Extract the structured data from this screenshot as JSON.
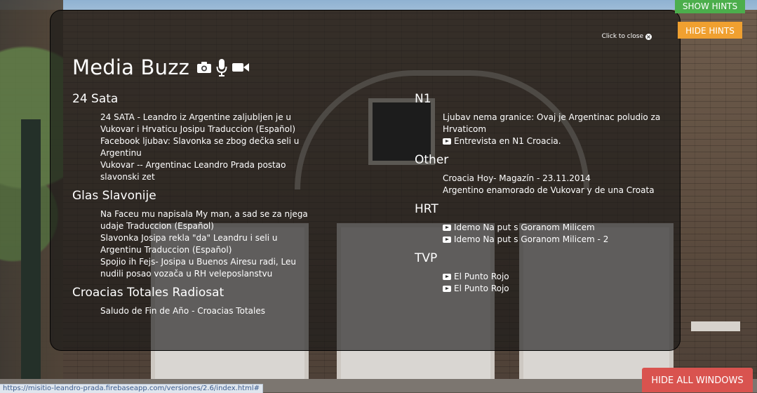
{
  "buttons": {
    "show_hints": "SHOW HINTS",
    "hide_hints": "HIDE HINTS",
    "hide_all_windows": "HIDE ALL WINDOWS"
  },
  "panel": {
    "close_label": "Click to close",
    "title": "Media Buzz",
    "title_icons": [
      "camera-icon",
      "microphone-icon",
      "video-camera-icon"
    ],
    "left_sections": [
      {
        "heading": "24 Sata",
        "items": [
          "24 SATA - Leandro iz Argentine zaljubljen je u Vukovar i Hrvaticu Josipu Traduccion (Español)",
          "Facebook ljubav: Slavonka se zbog dečka seli u Argentinu",
          "Vukovar -- Argentinac Leandro Prada postao slavonski zet"
        ]
      },
      {
        "heading": "Glas Slavonije",
        "items": [
          "Na Faceu mu napisala My man, a sad se za njega udaje Traduccion (Español)",
          "Slavonka Josipa rekla \"da\" Leandru i seli u Argentinu Traduccion (Español)",
          "Spojio ih Fejs- Josipa u Buenos Airesu radi, Leu nudili posao vozača u RH veleposlanstvu"
        ]
      },
      {
        "heading": "Croacias Totales Radiosat",
        "items": [
          "Saludo de Fin de Año - Croacias Totales"
        ]
      }
    ],
    "right_sections": [
      {
        "heading": "N1",
        "items": [
          {
            "text": "Ljubav nema granice: Ovaj je Argentinac poludio za Hrvaticom",
            "video": false
          },
          {
            "text": "Entrevista en N1 Croacia.",
            "video": true
          }
        ]
      },
      {
        "heading": "Other",
        "items": [
          {
            "text": "Croacia Hoy- Magazín - 23.11.2014",
            "video": false
          },
          {
            "text": "Argentino enamorado de Vukovar y de una Croata",
            "video": false
          }
        ]
      },
      {
        "heading": "HRT",
        "items": [
          {
            "text": "Idemo Na put s Goranom Milicem",
            "video": true
          },
          {
            "text": "Idemo Na put s Goranom Milicem - 2",
            "video": true
          }
        ]
      },
      {
        "heading": "TVP",
        "items": [
          {
            "text": "El Punto Rojo",
            "video": true
          },
          {
            "text": "El Punto Rojo",
            "video": true
          }
        ]
      }
    ]
  },
  "status_bar": {
    "url": "https://misitio-leandro-prada.firebaseapp.com/versiones/2.6/index.html#"
  },
  "colors": {
    "panel_bg": "rgba(20,20,20,0.62)",
    "show_hints_bg": "#4cae4c",
    "hide_hints_bg": "#f0a030",
    "hide_all_bg": "#d9534f"
  }
}
